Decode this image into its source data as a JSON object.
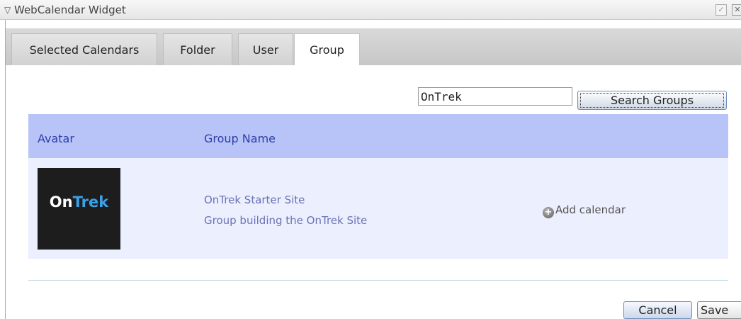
{
  "window": {
    "title": "WebCalendar Widget",
    "collapse_icon": "triangle-down-icon",
    "check_icon": "checkbox-icon",
    "close_icon": "close-icon"
  },
  "tabs": [
    {
      "label": "Selected Calendars",
      "active": false
    },
    {
      "label": "Folder",
      "active": false
    },
    {
      "label": "User",
      "active": false
    },
    {
      "label": "Group",
      "active": true
    }
  ],
  "search": {
    "value": "OnTrek",
    "button_label": "Search Groups"
  },
  "table": {
    "headers": [
      "Avatar",
      "Group Name"
    ],
    "rows": [
      {
        "avatar_logo": {
          "part1": "On",
          "part2": "Trek"
        },
        "group_name": "OnTrek Starter Site",
        "description": "Group building the OnTrek Site",
        "action_label": "Add calendar",
        "action_icon": "plus-circle-icon"
      }
    ]
  },
  "footer": {
    "cancel_label": "Cancel",
    "save_label": "Save"
  },
  "colors": {
    "header_bg": "#b8c4f8",
    "row_bg": "#ecf0fe",
    "link_text": "#6a72b6",
    "header_text": "#2d3fa8",
    "logo_accent": "#3aa0e8"
  }
}
